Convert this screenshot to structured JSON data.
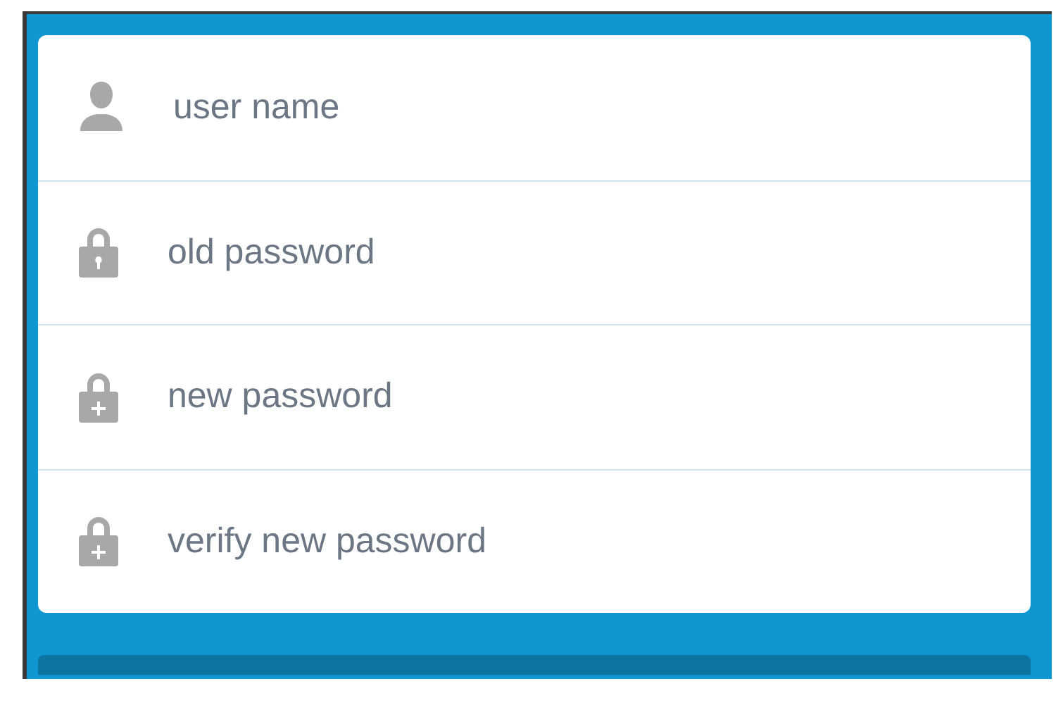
{
  "fields": [
    {
      "kind": "person",
      "placeholder": "user name"
    },
    {
      "kind": "lock",
      "placeholder": "old password"
    },
    {
      "kind": "lock-plus",
      "placeholder": "new password"
    },
    {
      "kind": "lock-plus",
      "placeholder": "verify new password"
    }
  ]
}
